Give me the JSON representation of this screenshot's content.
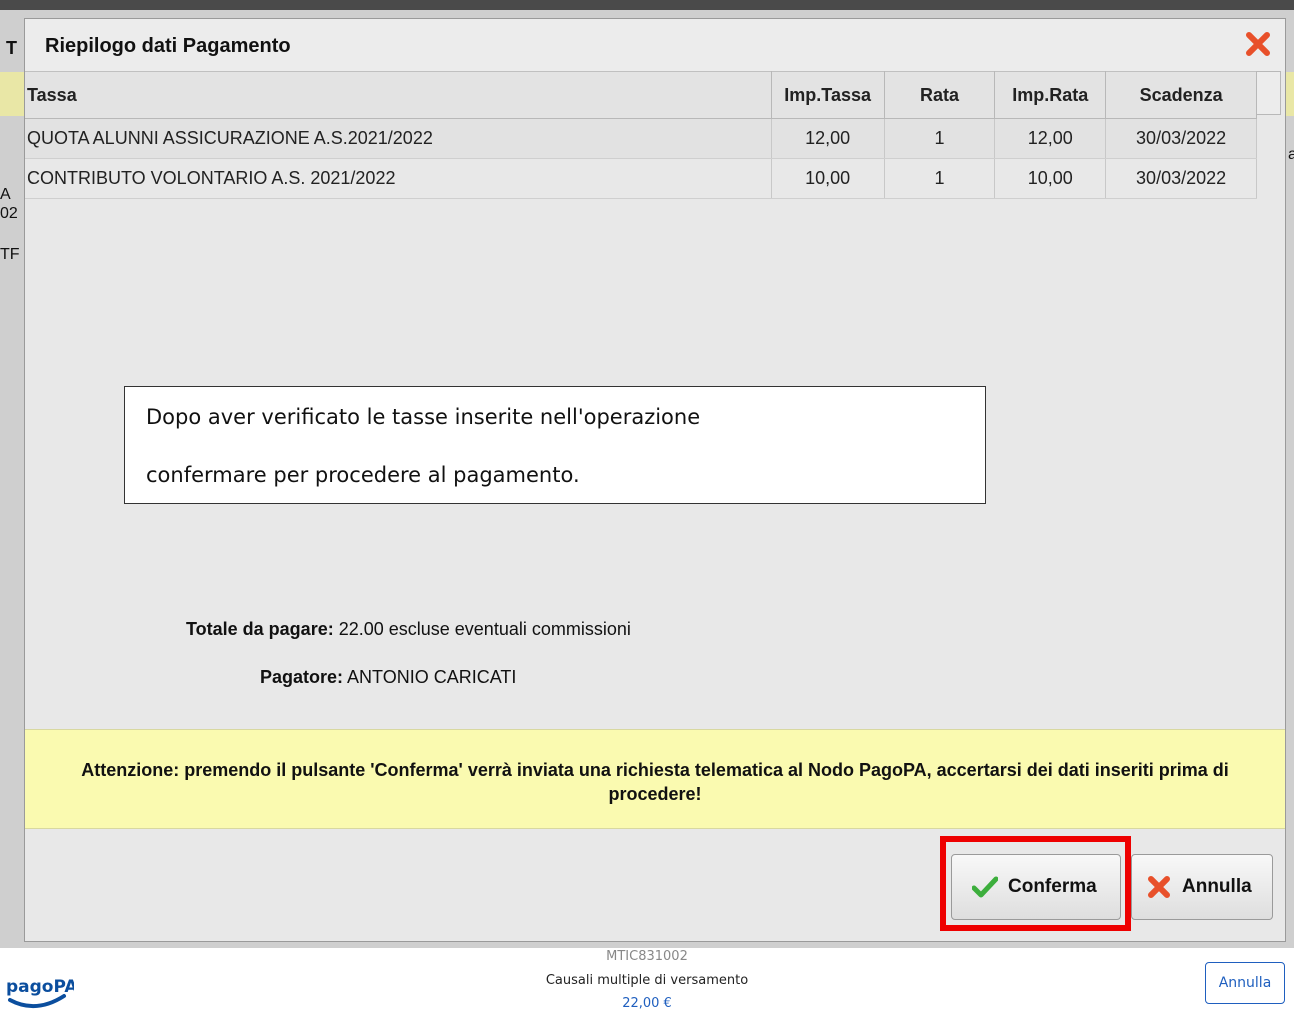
{
  "background": {
    "fragments": [
      "T",
      "A",
      "02",
      "TF",
      "a",
      "’",
      "’"
    ]
  },
  "modal": {
    "title": "Riepilogo dati Pagamento",
    "table": {
      "headers": [
        "Tassa",
        "Imp.Tassa",
        "Rata",
        "Imp.Rata",
        "Scadenza"
      ],
      "rows": [
        [
          "QUOTA ALUNNI ASSICURAZIONE A.S.2021/2022",
          "12,00",
          "1",
          "12,00",
          "30/03/2022"
        ],
        [
          "CONTRIBUTO VOLONTARIO A.S. 2021/2022",
          "10,00",
          "1",
          "10,00",
          "30/03/2022"
        ]
      ]
    },
    "note": {
      "line1": "Dopo aver verificato le tasse inserite nell'operazione",
      "line2": "confermare per procedere  al pagamento."
    },
    "summary": {
      "total_label": "Totale da pagare:",
      "total_value": " 22.00 escluse eventuali commissioni",
      "payer_label": "Pagatore:",
      "payer_value": " ANTONIO CARICATI"
    },
    "warning": "Attenzione: premendo il pulsante 'Conferma' verrà inviata una richiesta telematica al Nodo PagoPA, accertarsi dei dati inseriti prima di procedere!",
    "buttons": {
      "confirm_label": "Conferma",
      "cancel_label": "Annulla"
    },
    "colors": {
      "warning_bg": "#fafab0",
      "highlight": "#ee0000",
      "confirm_check": "#3cae3c",
      "close_x": "#e8502a"
    }
  },
  "footer": {
    "logo_text": "pagoPA",
    "code": "MTIC831002",
    "description": "Causali multiple di versamento",
    "amount": "22,00 €",
    "cancel_label": "Annulla",
    "accent": "#1f5fbf"
  }
}
